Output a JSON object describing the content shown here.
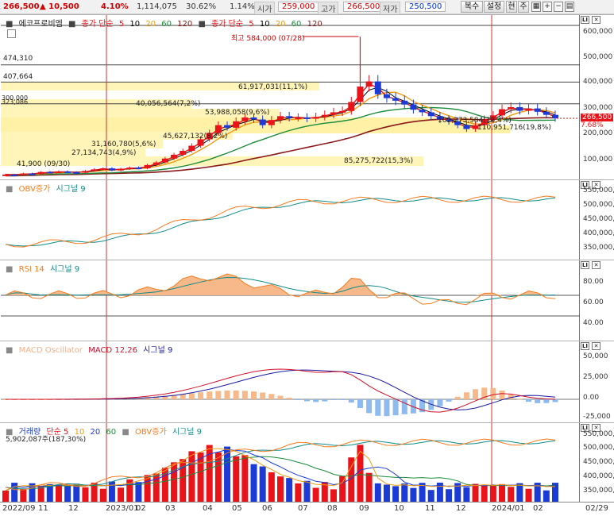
{
  "quote": {
    "price": "266,500",
    "change": "▲ 10,500",
    "change_pct": "4.10%",
    "volume": "1,114,075",
    "vol_ratio": "30.62%",
    "turnover": "1.14%",
    "open_label": "시가",
    "open_value": "259,000",
    "high_label": "고가",
    "high_value": "266,500",
    "low_label": "저가",
    "low_value": "250,500"
  },
  "toolbar": {
    "copy_label": "복수",
    "settings_label": "설정",
    "now_label": "현",
    "week_label": "주"
  },
  "colors": {
    "up": "#e8141a",
    "down": "#1c3bd6",
    "ma5": "#e8141a",
    "ma10": "#000000",
    "ma20": "#f29b11",
    "ma60": "#1e8c3c",
    "ma120": "#8b1a1a"
  },
  "price_panel": {
    "stock_name": "에코프로비엠",
    "ma_legend": {
      "price_ma_label": "종가 단순",
      "volume_ma_label": "종가 단순",
      "periods": [
        "5",
        "10",
        "20",
        "60",
        "120"
      ]
    },
    "y_ticks": [
      "600,000",
      "500,000",
      "400,000",
      "300,000",
      "200,000",
      "100,000"
    ],
    "level_labels": [
      "474,310",
      "407,664",
      "323,086"
    ],
    "level_label_overlap": "300,000",
    "high_note": "최고 584,000 (07/28)",
    "low_note": "41,900 (09/30)",
    "volume_profile": [
      "61,917,031(11,1%)",
      "40,056,564(7,2%)",
      "53,988,058(9,6%)",
      "45,627,132(8,2%)",
      "31,160,780(5,6%)",
      "27,134,743(4,9%)",
      "102,273,584(18,4%)",
      "110,951,716(19,8%)",
      "85,275,722(15,3%)"
    ],
    "current_price_tag": "266,500",
    "current_pct_tag": "7.68%"
  },
  "obv_panel": {
    "legend": [
      "OBV증가",
      "시그널 9"
    ],
    "y_ticks": [
      "550,000,",
      "500,000,",
      "450,000,",
      "400,000,",
      "350,000,"
    ]
  },
  "rsi_panel": {
    "legend": [
      "RSI 14",
      "시그널 9"
    ],
    "y_ticks": [
      "80.00",
      "60.00",
      "40.00"
    ]
  },
  "macd_panel": {
    "legend": [
      "MACD Oscillator",
      "MACD 12,26",
      "시그널 9"
    ],
    "y_ticks": [
      "50,000",
      "25,000",
      "0.00",
      "-25,000"
    ]
  },
  "volume_panel": {
    "legend": [
      "거래량",
      "단순 5",
      "10",
      "20",
      "60",
      "OBV증가",
      "시그널 9"
    ],
    "current": "5,902,087주(187,30%)",
    "y_ticks": [
      "550,000,",
      "500,000,",
      "450,000,",
      "400,000,",
      "350,000,"
    ]
  },
  "x_axis": {
    "ticks": [
      "2022/09",
      "11",
      "12",
      "2023/01",
      "02",
      "03",
      "04",
      "05",
      "06",
      "07",
      "08",
      "09",
      "10",
      "11",
      "12",
      "2024/01",
      "02",
      "02/29"
    ]
  },
  "chart_data": {
    "type": "candlestick",
    "months": [
      "2022/09",
      "2022/10",
      "2022/11",
      "2022/12",
      "2023/01",
      "2023/02",
      "2023/03",
      "2023/04",
      "2023/05",
      "2023/06",
      "2023/07",
      "2023/08",
      "2023/09",
      "2023/10",
      "2023/11",
      "2023/12",
      "2024/01",
      "2024/02"
    ],
    "weekly_close": [
      48000,
      47000,
      52000,
      50000,
      58000,
      56000,
      60000,
      57000,
      55000,
      62000,
      68000,
      72000,
      64000,
      70000,
      75000,
      72000,
      85000,
      95000,
      110000,
      125000,
      140000,
      160000,
      185000,
      210000,
      240000,
      230000,
      255000,
      270000,
      262000,
      240000,
      260000,
      275000,
      268000,
      270000,
      265000,
      272000,
      280000,
      290000,
      295000,
      330000,
      390000,
      410000,
      360000,
      345000,
      335000,
      320000,
      300000,
      290000,
      275000,
      262000,
      255000,
      240000,
      225000,
      240000,
      262000,
      278000,
      302000,
      310000,
      296000,
      305000,
      292000,
      280000,
      266500
    ],
    "ylim": [
      0,
      650000
    ]
  }
}
